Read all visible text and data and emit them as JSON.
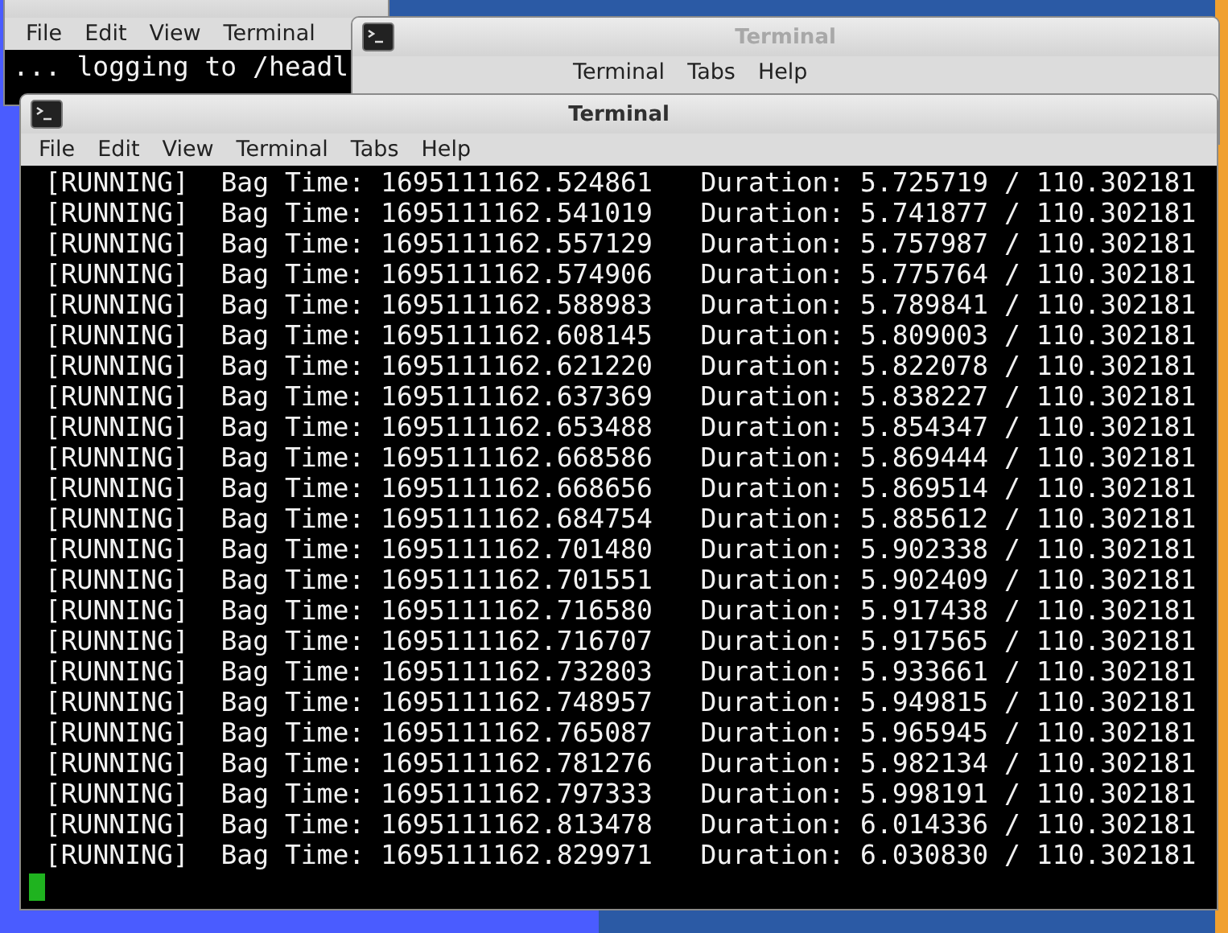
{
  "left_window": {
    "menu": [
      "File",
      "Edit",
      "View",
      "Terminal"
    ],
    "lines": [
      "... logging to /headl"
    ]
  },
  "middle_window": {
    "title": "Terminal",
    "menu": [
      "Terminal",
      "Tabs",
      "Help"
    ]
  },
  "front_window": {
    "title": "Terminal",
    "menu": [
      "File",
      "Edit",
      "View",
      "Terminal",
      "Tabs",
      "Help"
    ],
    "lines": [
      " [RUNNING]  Bag Time: 1695111162.524861   Duration: 5.725719 / 110.302181",
      " [RUNNING]  Bag Time: 1695111162.541019   Duration: 5.741877 / 110.302181",
      " [RUNNING]  Bag Time: 1695111162.557129   Duration: 5.757987 / 110.302181",
      " [RUNNING]  Bag Time: 1695111162.574906   Duration: 5.775764 / 110.302181",
      " [RUNNING]  Bag Time: 1695111162.588983   Duration: 5.789841 / 110.302181",
      " [RUNNING]  Bag Time: 1695111162.608145   Duration: 5.809003 / 110.302181",
      " [RUNNING]  Bag Time: 1695111162.621220   Duration: 5.822078 / 110.302181",
      " [RUNNING]  Bag Time: 1695111162.637369   Duration: 5.838227 / 110.302181",
      " [RUNNING]  Bag Time: 1695111162.653488   Duration: 5.854347 / 110.302181",
      " [RUNNING]  Bag Time: 1695111162.668586   Duration: 5.869444 / 110.302181",
      " [RUNNING]  Bag Time: 1695111162.668656   Duration: 5.869514 / 110.302181",
      " [RUNNING]  Bag Time: 1695111162.684754   Duration: 5.885612 / 110.302181",
      " [RUNNING]  Bag Time: 1695111162.701480   Duration: 5.902338 / 110.302181",
      " [RUNNING]  Bag Time: 1695111162.701551   Duration: 5.902409 / 110.302181",
      " [RUNNING]  Bag Time: 1695111162.716580   Duration: 5.917438 / 110.302181",
      " [RUNNING]  Bag Time: 1695111162.716707   Duration: 5.917565 / 110.302181",
      " [RUNNING]  Bag Time: 1695111162.732803   Duration: 5.933661 / 110.302181",
      " [RUNNING]  Bag Time: 1695111162.748957   Duration: 5.949815 / 110.302181",
      " [RUNNING]  Bag Time: 1695111162.765087   Duration: 5.965945 / 110.302181",
      " [RUNNING]  Bag Time: 1695111162.781276   Duration: 5.982134 / 110.302181",
      " [RUNNING]  Bag Time: 1695111162.797333   Duration: 5.998191 / 110.302181",
      " [RUNNING]  Bag Time: 1695111162.813478   Duration: 6.014336 / 110.302181",
      " [RUNNING]  Bag Time: 1695111162.829971   Duration: 6.030830 / 110.302181"
    ]
  }
}
